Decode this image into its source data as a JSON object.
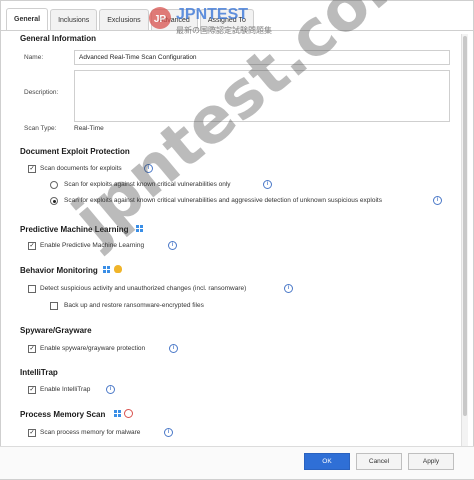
{
  "tabs": [
    "General",
    "Inclusions",
    "Exclusions",
    "Advanced",
    "Assigned To"
  ],
  "general": {
    "title": "General Information",
    "name_label": "Name:",
    "name_value": "Advanced Real-Time Scan Configuration",
    "description_label": "Description:",
    "scan_type_label": "Scan Type:",
    "scan_type_value": "Real-Time"
  },
  "exploit": {
    "title": "Document Exploit Protection",
    "scan_docs": "Scan documents for exploits",
    "option1": "Scan for exploits against known critical vulnerabilities only",
    "option2": "Scan for exploits against known critical vulnerabilities and aggressive detection of unknown suspicious exploits"
  },
  "pml": {
    "title": "Predictive Machine Learning",
    "enable": "Enable Predictive Machine Learning"
  },
  "behavior": {
    "title": "Behavior Monitoring",
    "detect": "Detect suspicious activity and unauthorized changes (incl. ransomware)",
    "backup": "Back up and restore ransomware-encrypted files"
  },
  "spyware": {
    "title": "Spyware/Grayware",
    "enable": "Enable spyware/grayware protection"
  },
  "intellitrap": {
    "title": "IntelliTrap",
    "enable": "Enable IntelliTrap"
  },
  "memory": {
    "title": "Process Memory Scan",
    "scan": "Scan process memory for malware"
  },
  "footer": {
    "ok": "OK",
    "cancel": "Cancel",
    "apply": "Apply"
  },
  "watermark": {
    "logo_text": "JPNTEST",
    "logo_sub": "最新の国際認定試験問題集",
    "diag_text": "jpntest.com"
  },
  "colors": {
    "accent": "#2f6fd6",
    "info": "#4b79c8",
    "windows": "#3a8ee6",
    "logo_red": "#d9534f"
  },
  "icons": [
    "info-icon",
    "windows-icon",
    "linux-icon"
  ]
}
